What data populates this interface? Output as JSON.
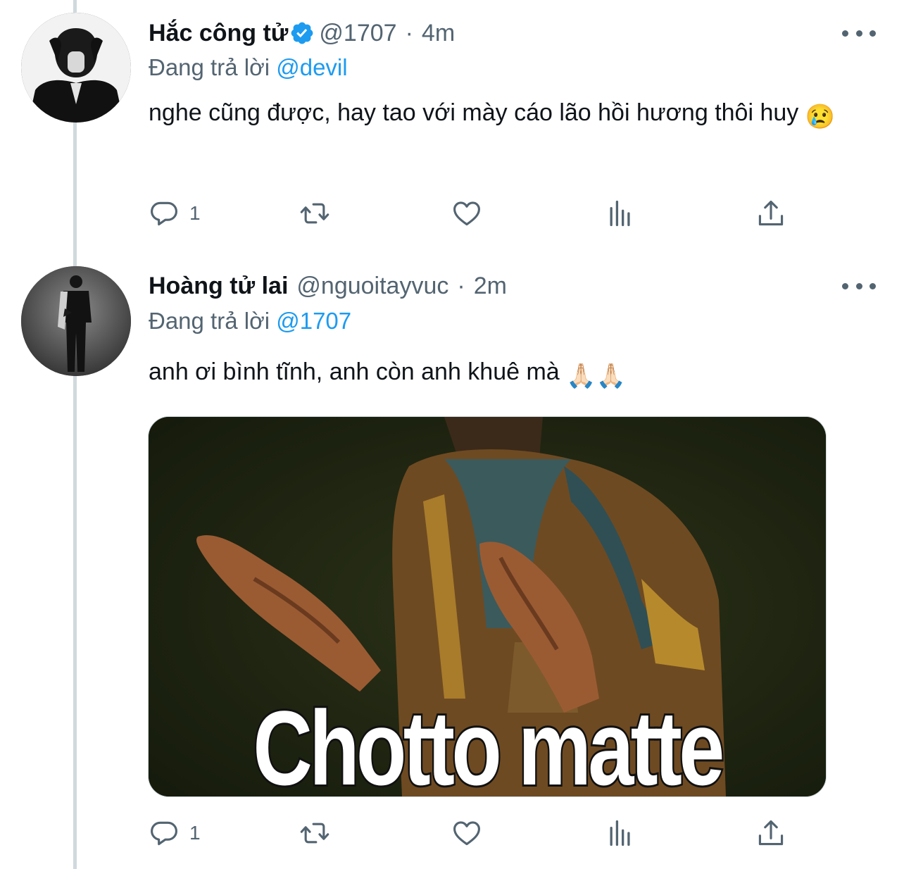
{
  "tweets": [
    {
      "name": "Hắc công tử",
      "verified": true,
      "handle": "@1707",
      "separator": "·",
      "time": "4m",
      "reply_prefix": "Đang trả lời",
      "reply_to": "@devil",
      "text": "nghe cũng được, hay tao với mày cáo lão hồi hương thôi huy",
      "emoji": "😢",
      "reply_count": "1"
    },
    {
      "name": "Hoàng tử lai",
      "verified": false,
      "handle": "@nguoitayvuc",
      "separator": "·",
      "time": "2m",
      "reply_prefix": "Đang trả lời",
      "reply_to": "@1707",
      "text": "anh ơi bình tĩnh, anh còn anh khuê mà",
      "emoji": "🙏🏻🙏🏻",
      "media_caption": "Chotto matte",
      "reply_count": "1"
    }
  ],
  "icons": [
    "reply-icon",
    "retweet-icon",
    "like-icon",
    "analytics-icon",
    "share-icon",
    "more-icon",
    "verified-badge-icon"
  ],
  "colors": {
    "accent": "#1d9bf0",
    "secondary_text": "#536471",
    "thread_line": "#cfd9de"
  }
}
